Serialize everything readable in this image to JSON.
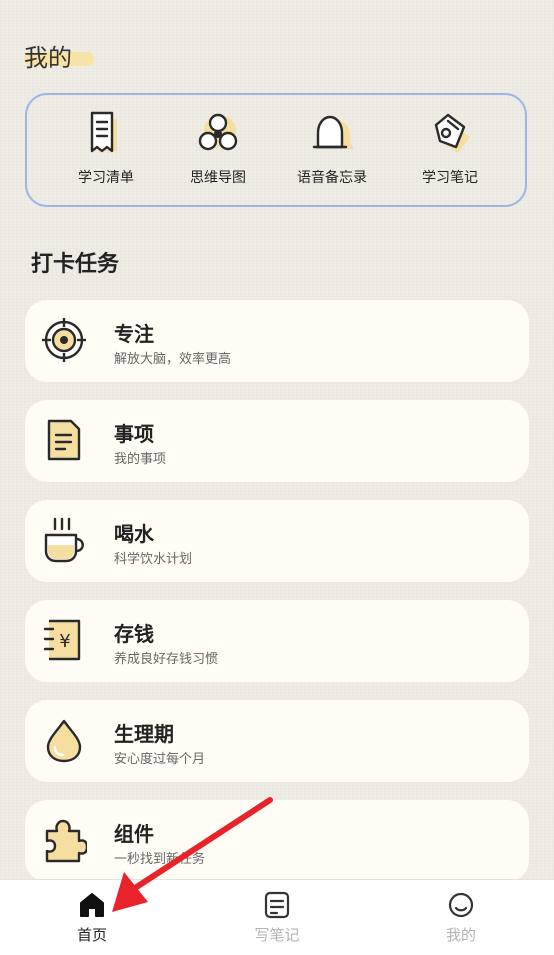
{
  "header": {
    "title": "我的"
  },
  "tools": [
    {
      "label": "学习清单",
      "icon": "study-list-icon"
    },
    {
      "label": "思维导图",
      "icon": "mind-map-icon"
    },
    {
      "label": "语音备忘录",
      "icon": "voice-memo-icon"
    },
    {
      "label": "学习笔记",
      "icon": "study-notes-icon"
    }
  ],
  "section": {
    "title": "打卡任务"
  },
  "tasks": [
    {
      "title": "专注",
      "subtitle": "解放大脑，效率更高",
      "icon": "target-icon"
    },
    {
      "title": "事项",
      "subtitle": "我的事项",
      "icon": "document-icon"
    },
    {
      "title": "喝水",
      "subtitle": "科学饮水计划",
      "icon": "cup-icon"
    },
    {
      "title": "存钱",
      "subtitle": "养成良好存钱习惯",
      "icon": "yuan-note-icon"
    },
    {
      "title": "生理期",
      "subtitle": "安心度过每个月",
      "icon": "drop-icon"
    },
    {
      "title": "组件",
      "subtitle": "一秒找到新任务",
      "icon": "puzzle-icon"
    }
  ],
  "tabbar": {
    "items": [
      {
        "label": "首页",
        "icon": "home-icon",
        "active": true
      },
      {
        "label": "写笔记",
        "icon": "note-icon",
        "active": false
      },
      {
        "label": "我的",
        "icon": "profile-icon",
        "active": false
      }
    ]
  },
  "colors": {
    "accent": "#f5dea0",
    "outline": "#2a2a2a",
    "border": "#9bb4ea",
    "arrow": "#e8242a"
  }
}
